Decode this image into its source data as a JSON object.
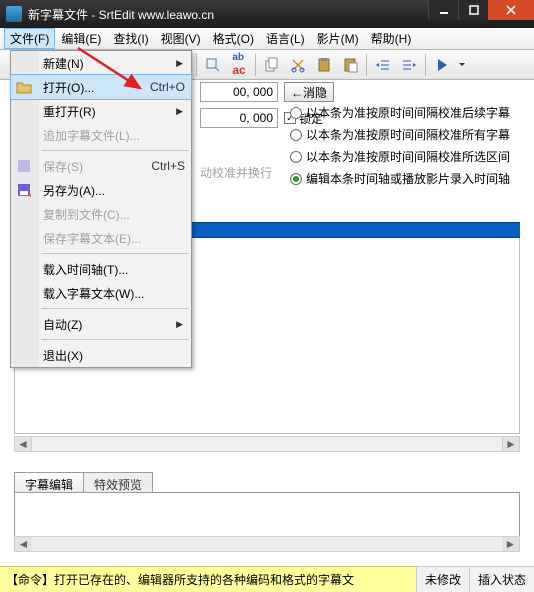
{
  "window": {
    "title": "新字幕文件 - SrtEdit www.leawo.cn"
  },
  "menubar": {
    "file": "文件(F)",
    "edit": "编辑(E)",
    "find": "查找(I)",
    "view": "视图(V)",
    "format": "格式(O)",
    "lang": "语言(L)",
    "movie": "影片(M)",
    "help": "帮助(H)"
  },
  "dropdown": {
    "new": "新建(N)",
    "open": "打开(O)...",
    "open_shortcut": "Ctrl+O",
    "reopen": "重打开(R)",
    "addsub": "追加字幕文件(L)...",
    "save": "保存(S)",
    "save_shortcut": "Ctrl+S",
    "saveas": "另存为(A)...",
    "copyto": "复制到文件(C)...",
    "savesubtext": "保存字幕文本(E)...",
    "loadtimeline": "载入时间轴(T)...",
    "loadsubtext": "载入字幕文本(W)...",
    "auto": "自动(Z)",
    "exit": "退出(X)"
  },
  "panel": {
    "num1": "00, 000",
    "btn_clearhide": "←消隐",
    "num2": "0, 000",
    "chk_lock": "锁定",
    "desc_disabled": "动校准并换行"
  },
  "radios": {
    "r1": "以本条为准按原时间间隔校准后续字幕",
    "r2": "以本条为准按原时间间隔校准所有字幕",
    "r3": "以本条为准按原时间间隔校准所选区间",
    "r4": "编辑本条时间轴或播放影片录入时间轴"
  },
  "tabs": {
    "t1": "字幕编辑",
    "t2": "特效预览"
  },
  "status": {
    "cmd": "【命令】打开已存在的、编辑器所支持的各种编码和格式的字幕文",
    "unmod": "未修改",
    "insert": "插入状态"
  }
}
